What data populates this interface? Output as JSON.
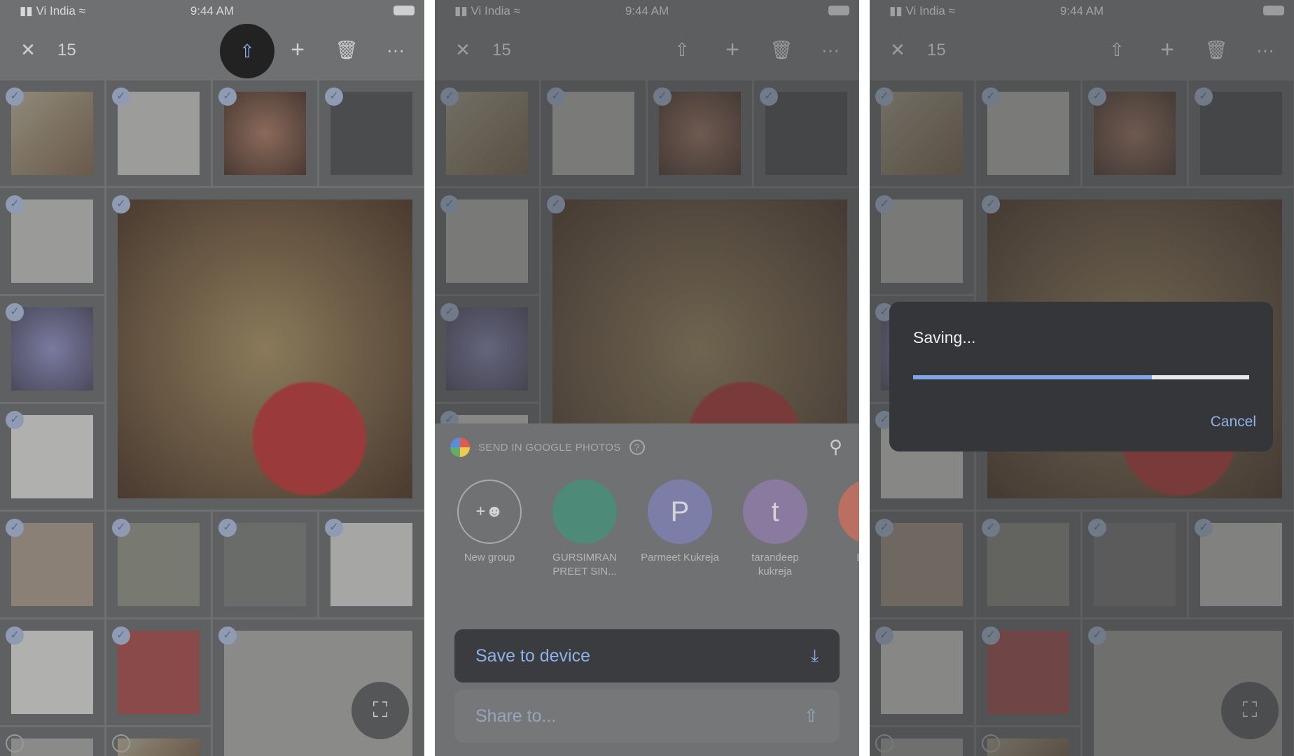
{
  "status": {
    "carrier": "Vi India",
    "time": "9:44 AM"
  },
  "toolbar": {
    "count": "15",
    "icons": [
      "close-icon",
      "share-icon",
      "add-icon",
      "trash-icon",
      "more-icon"
    ]
  },
  "sheet": {
    "title": "SEND IN GOOGLE PHOTOS",
    "contacts": [
      {
        "initial": "",
        "label": "New group",
        "color": "#707173"
      },
      {
        "initial": "",
        "label": "GURSIMRAN PREET SIN...",
        "color": "#4e8a78"
      },
      {
        "initial": "P",
        "label": "Parmeet Kukreja",
        "color": "#7c7ea8"
      },
      {
        "initial": "t",
        "label": "tarandeep kukreja",
        "color": "#8a7aa0"
      },
      {
        "initial": "B",
        "label": "Boxer",
        "color": "#b97060"
      }
    ],
    "save_label": "Save to device",
    "share_label": "Share to..."
  },
  "dialog": {
    "title": "Saving...",
    "progress": 0.71,
    "cancel_label": "Cancel"
  },
  "colors": {
    "accent": "#8fb1e8",
    "progress": "#7fa6e6"
  }
}
